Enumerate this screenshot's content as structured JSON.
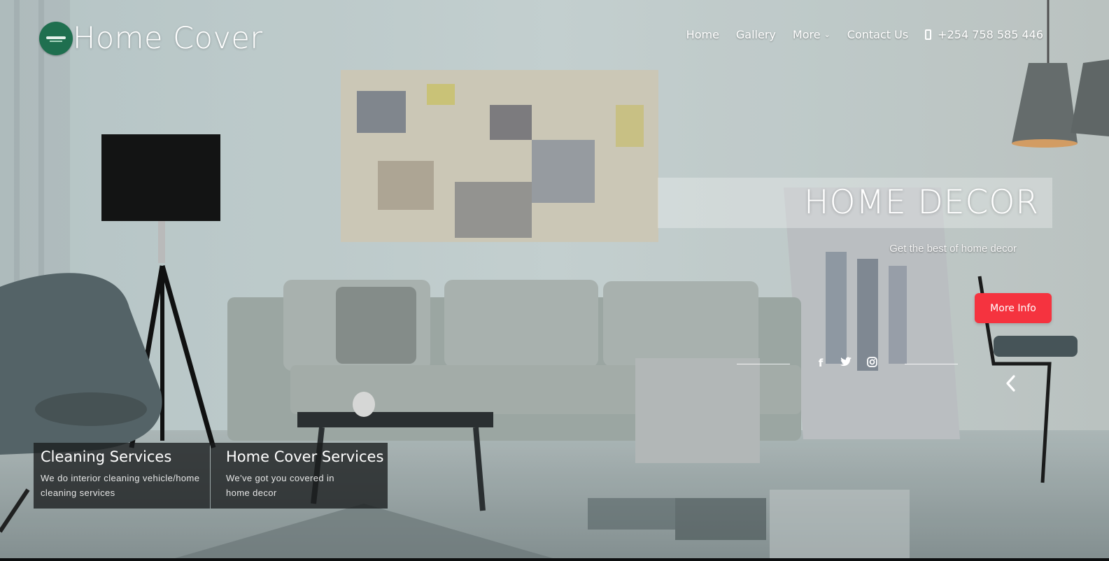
{
  "brand": {
    "name": "Home Cover",
    "logo_icon": "house-logo-icon"
  },
  "nav": {
    "items": [
      {
        "label": "Home"
      },
      {
        "label": "Gallery"
      },
      {
        "label": "More",
        "chevron": "⌄"
      },
      {
        "label": "Contact Us"
      }
    ],
    "phone": "+254 758 585 446"
  },
  "hero": {
    "title": "HOME DECOR",
    "subtitle": "Get the best of home decor",
    "cta_label": "More Info",
    "social": {
      "facebook": "f",
      "twitter": "t",
      "instagram": "instagram"
    }
  },
  "services": [
    {
      "title": "Cleaning Services",
      "description": "We do interior cleaning vehicle/home cleaning services"
    },
    {
      "title": "Home Cover Services",
      "description": "We've got you covered in home decor"
    }
  ],
  "colors": {
    "accent": "#f5333f",
    "brand_green": "#1f6f4f"
  }
}
